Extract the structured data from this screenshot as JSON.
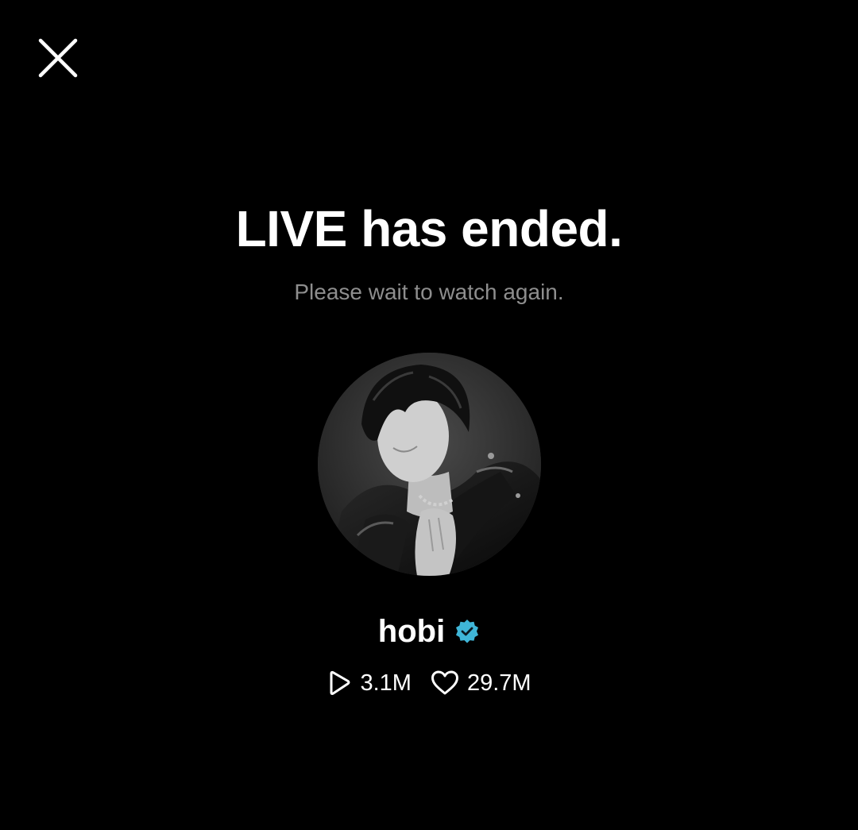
{
  "header": {
    "close_icon": "close-icon"
  },
  "main": {
    "title": "LIVE has ended.",
    "subtitle": "Please wait to watch again."
  },
  "profile": {
    "avatar_icon": "profile-photo",
    "name": "hobi",
    "verified_icon": "verified-badge-icon",
    "verified_color": "#3fb6d8"
  },
  "stats": {
    "plays_icon": "play-icon",
    "plays": "3.1M",
    "likes_icon": "heart-icon",
    "likes": "29.7M"
  },
  "colors": {
    "background": "#000000",
    "text_primary": "#ffffff",
    "text_secondary": "#8e8e8e"
  }
}
